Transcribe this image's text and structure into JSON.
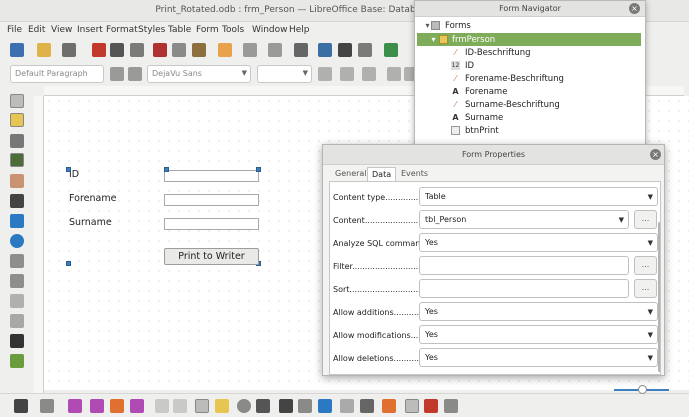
{
  "window": {
    "title": "Print_Rotated.odb : frm_Person — LibreOffice Base: Database Fo"
  },
  "menu": [
    "File",
    "Edit",
    "View",
    "Insert",
    "Format",
    "Styles",
    "Table",
    "Form",
    "Tools",
    "Window",
    "Help"
  ],
  "toolbar": {
    "paragraph_style": "Default Paragraph",
    "font_name": "DejaVu Sans",
    "font_size": ""
  },
  "form": {
    "labels": {
      "id": "ID",
      "forename": "Forename",
      "surname": "Surname"
    },
    "print_button": "Print to Writer"
  },
  "navigator": {
    "title": "Form Navigator",
    "root": "Forms",
    "form": "frmPerson",
    "items": [
      {
        "label": "ID-Beschriftung",
        "icon": "label-icon"
      },
      {
        "label": "ID",
        "icon": "numeric-field-icon"
      },
      {
        "label": "Forename-Beschriftung",
        "icon": "label-icon"
      },
      {
        "label": "Forename",
        "icon": "text-field-icon"
      },
      {
        "label": "Surname-Beschriftung",
        "icon": "label-icon"
      },
      {
        "label": "Surname",
        "icon": "text-field-icon"
      },
      {
        "label": "btnPrint",
        "icon": "button-icon"
      }
    ]
  },
  "properties": {
    "title": "Form Properties",
    "tabs": [
      "General",
      "Data",
      "Events"
    ],
    "active_tab": "Data",
    "rows": [
      {
        "label": "Content type..........................",
        "value": "Table",
        "kind": "select"
      },
      {
        "label": "Content.......................................",
        "value": "tbl_Person",
        "kind": "combo"
      },
      {
        "label": "Analyze SQL command...",
        "value": "Yes",
        "kind": "select"
      },
      {
        "label": "Filter..........................................",
        "value": "",
        "kind": "text"
      },
      {
        "label": "Sort............................................",
        "value": "",
        "kind": "text"
      },
      {
        "label": "Allow additions...................",
        "value": "Yes",
        "kind": "select"
      },
      {
        "label": "Allow modifications............",
        "value": "Yes",
        "kind": "select"
      },
      {
        "label": "Allow deletions.................",
        "value": "Yes",
        "kind": "select"
      }
    ],
    "browse_label": "..."
  },
  "colors": {
    "selection": "#7fac58",
    "desktop": "#55702f",
    "handle": "#3d7ebf"
  }
}
